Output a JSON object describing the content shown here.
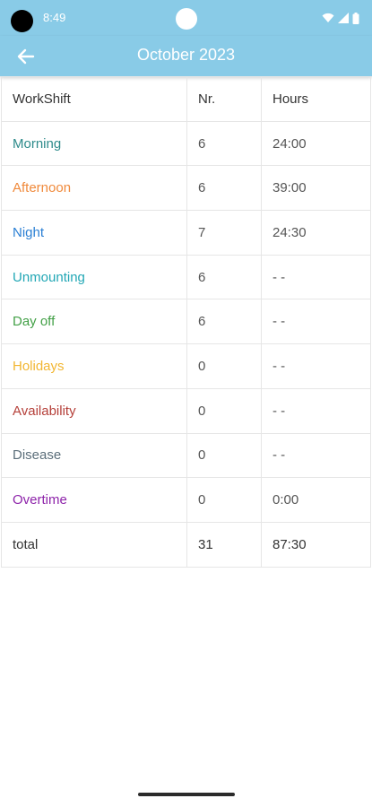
{
  "status_bar": {
    "time": "8:49"
  },
  "app_bar": {
    "title": "October 2023",
    "back_icon": "arrow-left-icon"
  },
  "table": {
    "headers": [
      "WorkShift",
      "Nr.",
      "Hours"
    ],
    "rows": [
      {
        "shift": "Morning",
        "nr": "6",
        "hours": "24:00",
        "color": "#2e8b8b"
      },
      {
        "shift": "Afternoon",
        "nr": "6",
        "hours": "39:00",
        "color": "#f08a3c"
      },
      {
        "shift": "Night",
        "nr": "7",
        "hours": "24:30",
        "color": "#2a7fd4"
      },
      {
        "shift": "Unmounting",
        "nr": "6",
        "hours": "- -",
        "color": "#22a7b5"
      },
      {
        "shift": "Day off",
        "nr": "6",
        "hours": "- -",
        "color": "#43a047"
      },
      {
        "shift": "Holidays",
        "nr": "0",
        "hours": "- -",
        "color": "#f2b632"
      },
      {
        "shift": "Availability",
        "nr": "0",
        "hours": "- -",
        "color": "#b5403a"
      },
      {
        "shift": "Disease",
        "nr": "0",
        "hours": "- -",
        "color": "#5b6e7a"
      },
      {
        "shift": "Overtime",
        "nr": "0",
        "hours": "0:00",
        "color": "#8e24aa"
      }
    ],
    "total": {
      "label": "total",
      "nr": "31",
      "hours": "87:30"
    }
  },
  "colors": {
    "app_bar": "#89cbe7",
    "header_text": "#333333",
    "total_text": "#333333"
  }
}
